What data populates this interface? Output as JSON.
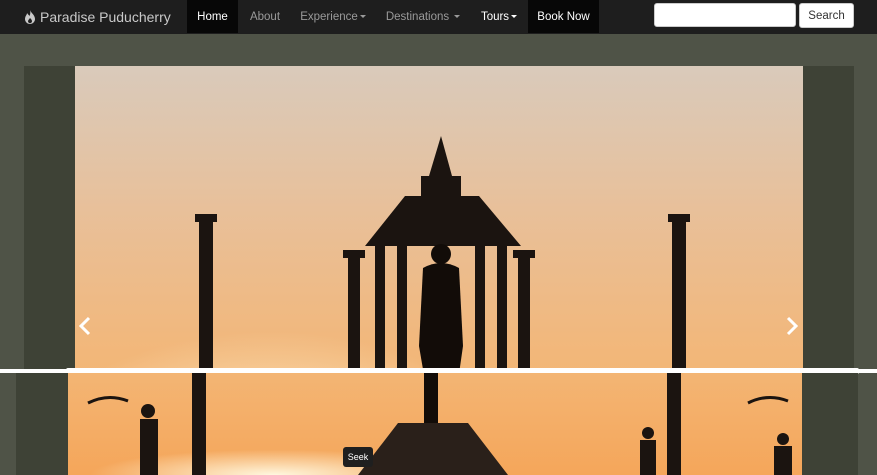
{
  "brand": {
    "name": "Paradise Puducherry",
    "icon": "flame-logo-icon"
  },
  "nav": {
    "home": "Home",
    "about": "About",
    "experience": "Experience",
    "destinations": "Destinations",
    "tours": "Tours",
    "book": "Book Now"
  },
  "search": {
    "placeholder": "",
    "button": "Search"
  },
  "carousel": {
    "prev_icon": "chevron-left-icon",
    "next_icon": "chevron-right-icon"
  },
  "player": {
    "seek_label": "Seek"
  },
  "colors": {
    "navbar": "#1e1e1e",
    "active_nav": "#070707",
    "page_bg": "#4f5347",
    "sky_warm": "#f3c28f"
  }
}
